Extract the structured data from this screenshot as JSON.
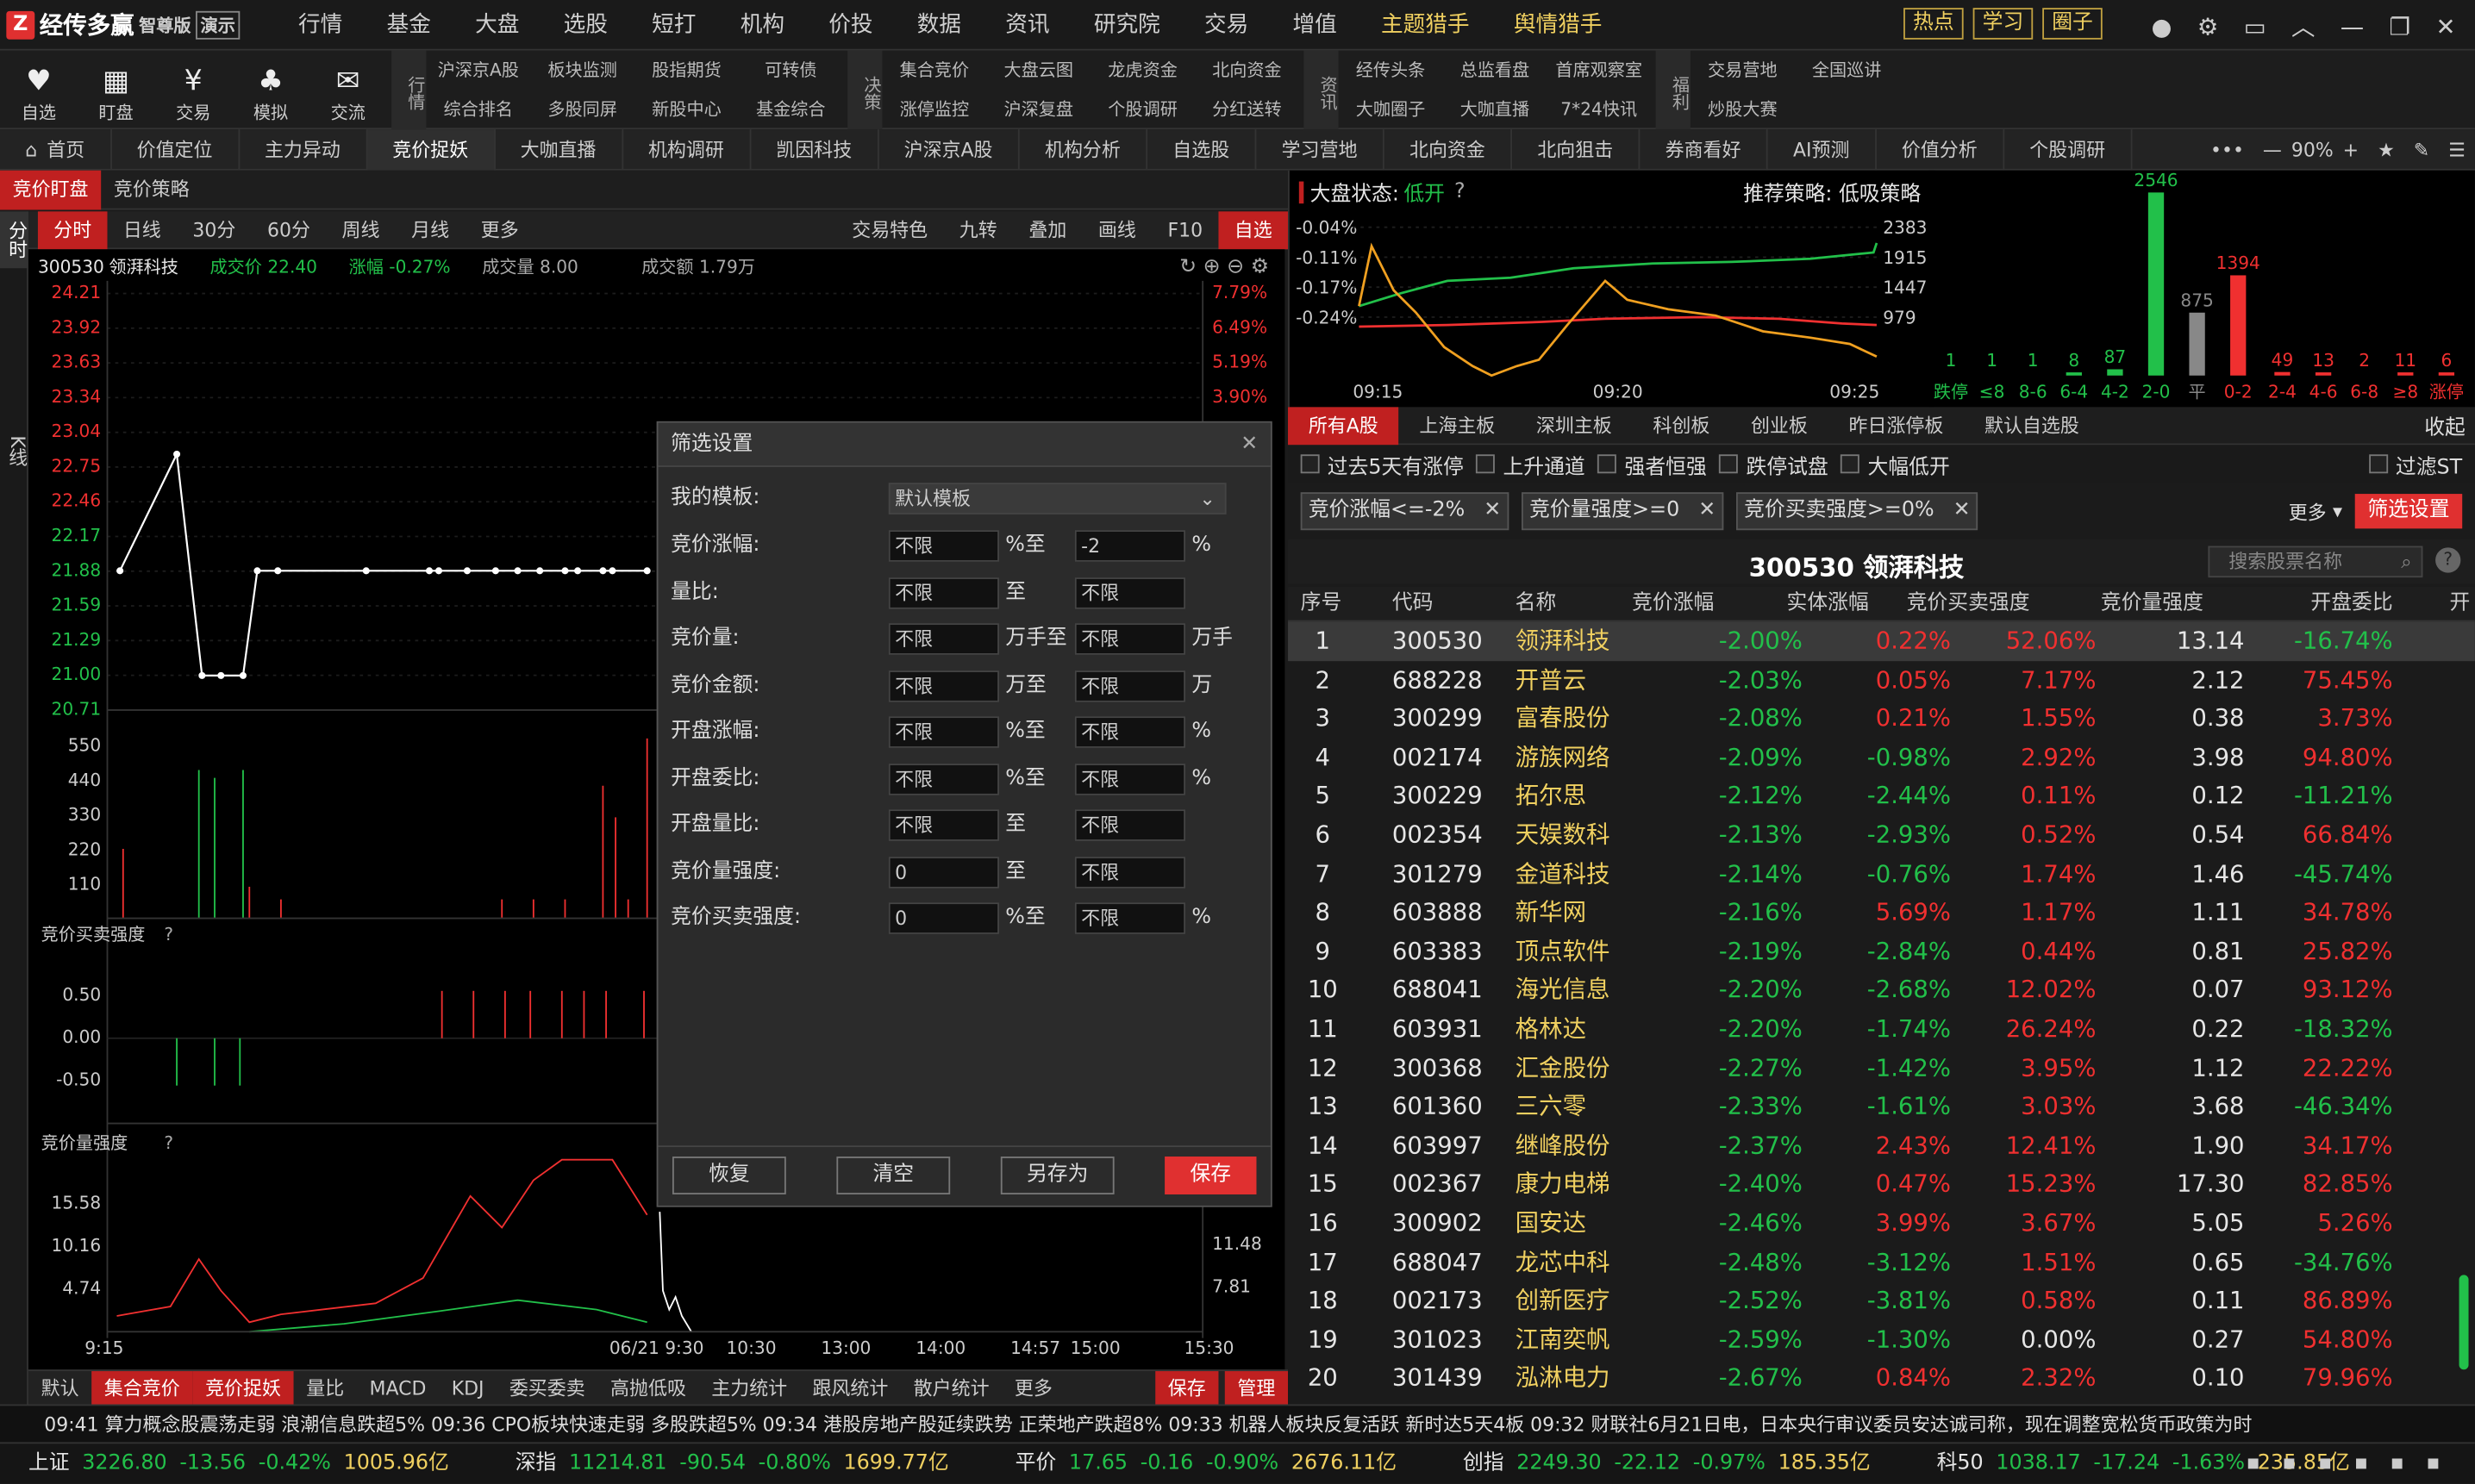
{
  "app": {
    "logo": "经传多赢",
    "edition": "智尊版",
    "demo": "演示"
  },
  "menu": [
    {
      "label": "行情"
    },
    {
      "label": "基金"
    },
    {
      "label": "大盘",
      "dot": true
    },
    {
      "label": "选股",
      "dot": true
    },
    {
      "label": "短打"
    },
    {
      "label": "机构",
      "dot": true
    },
    {
      "label": "价投"
    },
    {
      "label": "数据"
    },
    {
      "label": "资讯"
    },
    {
      "label": "研究院",
      "dot": true
    },
    {
      "label": "交易"
    },
    {
      "label": "增值"
    },
    {
      "label": "主题猎手",
      "hl": true
    },
    {
      "label": "舆情猎手",
      "hl": true,
      "dot": true
    }
  ],
  "top_buttons": [
    "热点",
    "学习",
    "圈子"
  ],
  "toolbar_icons": [
    {
      "label": "自选",
      "icon": "heart-icon"
    },
    {
      "label": "盯盘",
      "icon": "chart-icon"
    },
    {
      "label": "交易",
      "icon": "yen-icon"
    },
    {
      "label": "模拟",
      "icon": "gamepad-icon"
    },
    {
      "label": "交流",
      "icon": "chat-icon"
    }
  ],
  "toolbar_groups": [
    {
      "name": "行情",
      "cols": [
        [
          "沪深京A股",
          "综合排名"
        ],
        [
          "板块监测",
          "多股同屏"
        ],
        [
          "股指期货",
          "新股中心"
        ],
        [
          "可转债",
          "基金综合"
        ]
      ]
    },
    {
      "name": "决策",
      "cols": [
        [
          "集合竞价",
          "涨停监控"
        ],
        [
          "大盘云图",
          "沪深复盘"
        ],
        [
          "龙虎资金",
          "个股调研"
        ],
        [
          "北向资金",
          "分红送转"
        ]
      ]
    },
    {
      "name": "资讯",
      "cols": [
        [
          "经传头条",
          "大咖圈子"
        ],
        [
          "总监看盘",
          "大咖直播"
        ],
        [
          "首席观察室",
          "7*24快讯"
        ]
      ]
    },
    {
      "name": "福利",
      "cols": [
        [
          "交易营地",
          "炒股大赛"
        ],
        [
          "全国巡讲",
          ""
        ]
      ]
    }
  ],
  "tabs": [
    "首页",
    "价值定位",
    "主力异动",
    "竞价捉妖",
    "大咖直播",
    "机构调研",
    "凯因科技",
    "沪深京A股",
    "机构分析",
    "自选股",
    "学习营地",
    "北向资金",
    "北向狙击",
    "券商看好",
    "AI预测",
    "价值分析",
    "个股调研"
  ],
  "active_tab": "竞价捉妖",
  "zoom": "90%",
  "left_sub": [
    "竞价盯盘",
    "竞价策略"
  ],
  "period_tabs": [
    "分时",
    "日线",
    "30分",
    "60分",
    "周线",
    "月线",
    "更多"
  ],
  "right_tools": [
    "交易特色",
    "九转",
    "叠加",
    "画线",
    "F10",
    "自选"
  ],
  "side_tabs": [
    "分时",
    "K线"
  ],
  "stock_info": {
    "code": "300530",
    "name": "领湃科技",
    "price_label": "成交价 22.40",
    "chg_label": "涨幅 -0.27%",
    "vol_label": "成交量 8.00",
    "amt_label": "成交额 1.79万"
  },
  "price_axis": [
    "24.21",
    "23.92",
    "23.63",
    "23.34",
    "23.04",
    "22.75",
    "22.46",
    "22.17",
    "21.88",
    "21.59",
    "21.29",
    "21.00",
    "20.71"
  ],
  "pct_axis": [
    "7.79%",
    "6.49%",
    "5.19%",
    "3.90%"
  ],
  "vol_axis": [
    "550",
    "440",
    "330",
    "220",
    "110"
  ],
  "buy_strength_label": "竞价买卖强度",
  "buy_axis": [
    "0.50",
    "0.00",
    "-0.50"
  ],
  "vol_strength_label": "竞价量强度",
  "vs_axis": [
    "15.58",
    "10.16",
    "4.74"
  ],
  "vs_right_axis": [
    "11.48",
    "7.81"
  ],
  "time_axis": [
    "9:15",
    "06/21 9:30",
    "10:30",
    "13:00",
    "14:00",
    "14:57",
    "15:00",
    "15:30"
  ],
  "indicators": [
    "默认",
    "集合竞价",
    "竞价捉妖",
    "量比",
    "MACD",
    "KDJ",
    "委买委卖",
    "高抛低吸",
    "主力统计",
    "跟风统计",
    "散户统计",
    "更多",
    "保存",
    "管理"
  ],
  "dialog": {
    "title": "筛选设置",
    "template_label": "我的模板:",
    "template_value": "默认模板",
    "rows": [
      {
        "label": "竞价涨幅:",
        "a": "不限",
        "u1": "%至",
        "b": "-2",
        "u2": "%"
      },
      {
        "label": "量比:",
        "a": "不限",
        "u1": "至",
        "b": "不限",
        "u2": ""
      },
      {
        "label": "竞价量:",
        "a": "不限",
        "u1": "万手至",
        "b": "不限",
        "u2": "万手"
      },
      {
        "label": "竞价金额:",
        "a": "不限",
        "u1": "万至",
        "b": "不限",
        "u2": "万"
      },
      {
        "label": "开盘涨幅:",
        "a": "不限",
        "u1": "%至",
        "b": "不限",
        "u2": "%"
      },
      {
        "label": "开盘委比:",
        "a": "不限",
        "u1": "%至",
        "b": "不限",
        "u2": "%"
      },
      {
        "label": "开盘量比:",
        "a": "不限",
        "u1": "至",
        "b": "不限",
        "u2": ""
      },
      {
        "label": "竞价量强度:",
        "a": "0",
        "u1": "至",
        "b": "不限",
        "u2": ""
      },
      {
        "label": "竞价买卖强度:",
        "a": "0",
        "u1": "%至",
        "b": "不限",
        "u2": "%"
      }
    ],
    "buttons": [
      "恢复",
      "清空",
      "另存为",
      "保存"
    ]
  },
  "market": {
    "status_label": "大盘状态:",
    "status": "低开",
    "strategy": "推荐策略: 低吸策略",
    "y_left": [
      "-0.04%",
      "-0.11%",
      "-0.17%",
      "-0.24%"
    ],
    "y_right": [
      "2383",
      "1915",
      "1447",
      "979"
    ],
    "x": [
      "09:15",
      "09:20",
      "09:25"
    ]
  },
  "dist": {
    "values": [
      "1",
      "1",
      "1",
      "8",
      "87",
      "2546",
      "875",
      "1394",
      "49",
      "13",
      "2",
      "11",
      "6"
    ],
    "labels": [
      "跌停",
      "≤8",
      "8-6",
      "6-4",
      "4-2",
      "2-0",
      "平",
      "0-2",
      "2-4",
      "4-6",
      "6-8",
      "≥8",
      "涨停"
    ]
  },
  "filter_tabs": [
    "所有A股",
    "上海主板",
    "深圳主板",
    "科创板",
    "创业板",
    "昨日涨停板",
    "默认自选股"
  ],
  "collapse": "收起",
  "checks": [
    "过去5天有涨停",
    "上升通道",
    "强者恒强",
    "跌停试盘",
    "大幅低开"
  ],
  "filter_st": "过滤ST",
  "conditions": [
    "竞价涨幅<=-2%",
    "竞价量强度>=0",
    "竞价买卖强度>=0%"
  ],
  "more": "更多",
  "filter_btn": "筛选设置",
  "table_title": "300530  领湃科技",
  "search_placeholder": "搜索股票名称",
  "columns": [
    "序号",
    "代码",
    "名称",
    "竞价涨幅",
    "实体涨幅",
    "竞价买卖强度",
    "竞价量强度",
    "开盘委比",
    "开"
  ],
  "rows": [
    [
      "1",
      "300530",
      "领湃科技",
      "-2.00%",
      "0.22%",
      "52.06%",
      "13.14",
      "-16.74%"
    ],
    [
      "2",
      "688228",
      "开普云",
      "-2.03%",
      "0.05%",
      "7.17%",
      "2.12",
      "75.45%"
    ],
    [
      "3",
      "300299",
      "富春股份",
      "-2.08%",
      "0.21%",
      "1.55%",
      "0.38",
      "3.73%"
    ],
    [
      "4",
      "002174",
      "游族网络",
      "-2.09%",
      "-0.98%",
      "2.92%",
      "3.98",
      "94.80%"
    ],
    [
      "5",
      "300229",
      "拓尔思",
      "-2.12%",
      "-2.44%",
      "0.11%",
      "0.12",
      "-11.21%"
    ],
    [
      "6",
      "002354",
      "天娱数科",
      "-2.13%",
      "-2.93%",
      "0.52%",
      "0.54",
      "66.84%"
    ],
    [
      "7",
      "301279",
      "金道科技",
      "-2.14%",
      "-0.76%",
      "1.74%",
      "1.46",
      "-45.74%"
    ],
    [
      "8",
      "603888",
      "新华网",
      "-2.16%",
      "5.69%",
      "1.17%",
      "1.11",
      "34.78%"
    ],
    [
      "9",
      "603383",
      "顶点软件",
      "-2.19%",
      "-2.84%",
      "0.44%",
      "0.81",
      "25.82%"
    ],
    [
      "10",
      "688041",
      "海光信息",
      "-2.20%",
      "-2.68%",
      "12.02%",
      "0.07",
      "93.12%"
    ],
    [
      "11",
      "603931",
      "格林达",
      "-2.20%",
      "-1.74%",
      "26.24%",
      "0.22",
      "-18.32%"
    ],
    [
      "12",
      "300368",
      "汇金股份",
      "-2.27%",
      "-1.42%",
      "3.95%",
      "1.12",
      "22.22%"
    ],
    [
      "13",
      "601360",
      "三六零",
      "-2.33%",
      "-1.61%",
      "3.03%",
      "3.68",
      "-46.34%"
    ],
    [
      "14",
      "603997",
      "继峰股份",
      "-2.37%",
      "2.43%",
      "12.41%",
      "1.90",
      "34.17%"
    ],
    [
      "15",
      "002367",
      "康力电梯",
      "-2.40%",
      "0.47%",
      "15.23%",
      "17.30",
      "82.85%"
    ],
    [
      "16",
      "300902",
      "国安达",
      "-2.46%",
      "3.99%",
      "3.67%",
      "5.05",
      "5.26%"
    ],
    [
      "17",
      "688047",
      "龙芯中科",
      "-2.48%",
      "-3.12%",
      "1.51%",
      "0.65",
      "-34.76%"
    ],
    [
      "18",
      "002173",
      "创新医疗",
      "-2.52%",
      "-3.81%",
      "0.58%",
      "0.11",
      "86.89%"
    ],
    [
      "19",
      "301023",
      "江南奕帆",
      "-2.59%",
      "-1.30%",
      "0.00%",
      "0.27",
      "54.80%"
    ],
    [
      "20",
      "301439",
      "泓淋电力",
      "-2.67%",
      "0.84%",
      "2.32%",
      "0.10",
      "79.96%"
    ]
  ],
  "news": "09:41 算力概念股震荡走弱 浪潮信息跌超5%    09:36 CPO板块快速走弱 多股跌超5%    09:34 港股房地产股延续跌势 正荣地产跌超8%    09:33 机器人板块反复活跃 新时达5天4板    09:32 财联社6月21日电，日本央行审议委员安达诚司称，现在调整宽松货币政策为时",
  "indices": [
    {
      "name": "上证",
      "val": "3226.80",
      "chg": "-13.56",
      "pct": "-0.42%",
      "amt": "1005.96亿"
    },
    {
      "name": "深指",
      "val": "11214.81",
      "chg": "-90.54",
      "pct": "-0.80%",
      "amt": "1699.77亿"
    },
    {
      "name": "平价",
      "val": "17.65",
      "chg": "-0.16",
      "pct": "-0.90%",
      "amt": "2676.11亿"
    },
    {
      "name": "创指",
      "val": "2249.30",
      "chg": "-22.12",
      "pct": "-0.97%",
      "amt": "185.35亿"
    },
    {
      "name": "科50",
      "val": "1038.17",
      "chg": "-17.24",
      "pct": "-1.63%",
      "amt": "235.85亿"
    }
  ],
  "intraday_price": [
    21.88,
    22.86,
    21.0,
    21.0,
    21.0,
    21.88,
    21.88,
    21.88,
    21.88,
    21.88,
    21.88,
    21.88,
    21.88,
    21.88,
    21.88,
    21.88,
    21.88,
    21.88,
    21.88
  ],
  "colors": {
    "accent": "#c02020",
    "up": "#f03030",
    "down": "#22c04a",
    "highlight": "#f0d060"
  }
}
